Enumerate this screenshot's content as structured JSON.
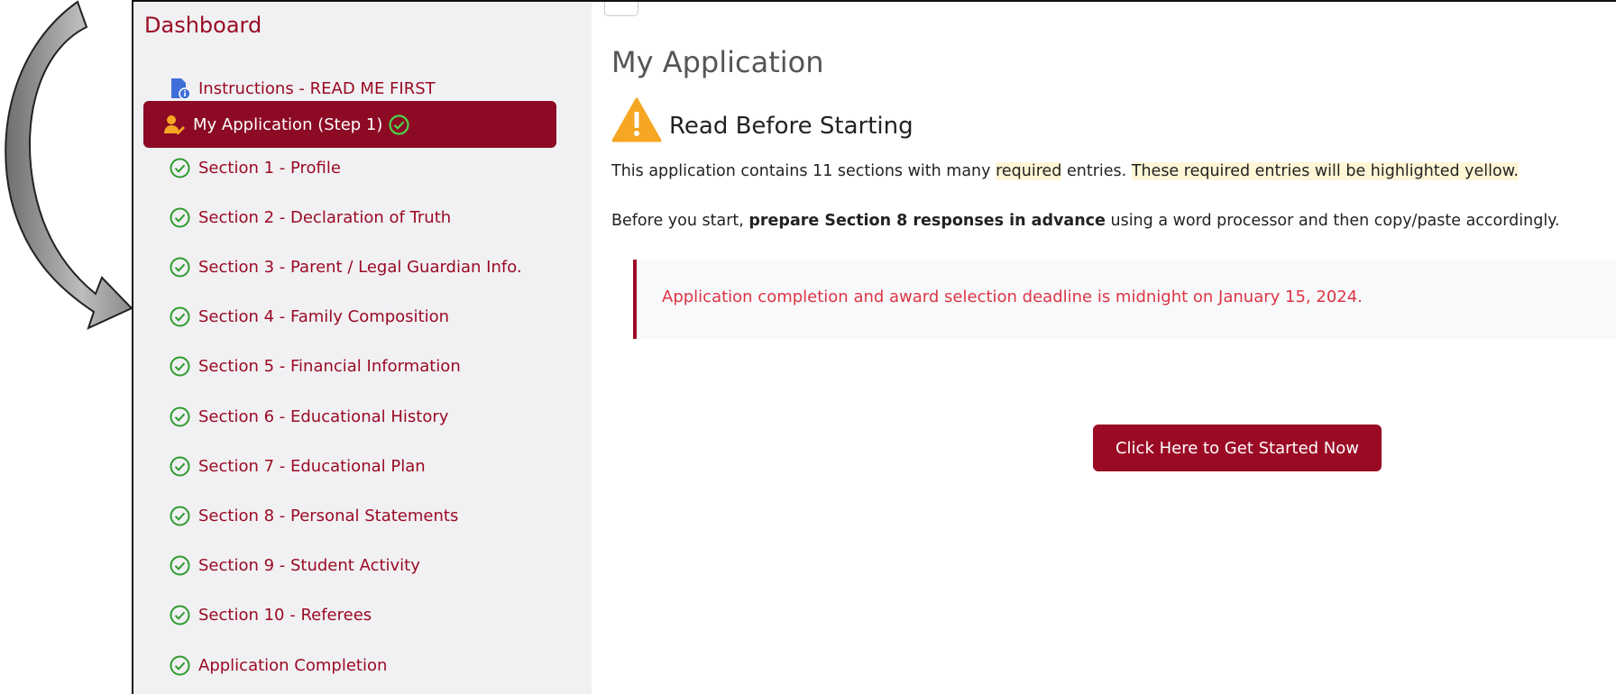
{
  "colors": {
    "brand": "#9b0a24",
    "active_bg": "#8c0a24",
    "check_green": "#2e9b2e",
    "highlight": "#fff6d6",
    "alert_text": "#dc3545"
  },
  "sidebar": {
    "title": "Dashboard",
    "items": [
      {
        "label": "Instructions - READ ME FIRST",
        "icon": "file-info-icon"
      },
      {
        "label": "My Application (Step 1)",
        "icon": "user-edit-icon",
        "active": true
      },
      {
        "label": "Section 1 - Profile",
        "icon": "check-circle-icon"
      },
      {
        "label": "Section 2 - Declaration of Truth",
        "icon": "check-circle-icon"
      },
      {
        "label": "Section 3 - Parent / Legal Guardian Info.",
        "icon": "check-circle-icon"
      },
      {
        "label": "Section 4 - Family Composition",
        "icon": "check-circle-icon"
      },
      {
        "label": "Section 5 - Financial Information",
        "icon": "check-circle-icon"
      },
      {
        "label": "Section 6 - Educational History",
        "icon": "check-circle-icon"
      },
      {
        "label": "Section 7 - Educational Plan",
        "icon": "check-circle-icon"
      },
      {
        "label": "Section 8 - Personal Statements",
        "icon": "check-circle-icon"
      },
      {
        "label": "Section 9 - Student Activity",
        "icon": "check-circle-icon"
      },
      {
        "label": "Section 10 - Referees",
        "icon": "check-circle-icon"
      },
      {
        "label": "Application Completion",
        "icon": "check-circle-icon"
      }
    ]
  },
  "main": {
    "title": "My Application",
    "notice_heading": "Read Before Starting",
    "para1": {
      "a": "This application contains 11 sections with many ",
      "b": "required",
      "c": " entries. ",
      "d": "These required entries will be highlighted yellow."
    },
    "para2": {
      "a": "Before you start, ",
      "b": "prepare Section 8 responses in advance",
      "c": " using a word processor and then copy/paste accordingly."
    },
    "deadline": "Application completion and award selection deadline is midnight on January 15, 2024.",
    "cta_label": "Click Here to Get Started Now"
  }
}
